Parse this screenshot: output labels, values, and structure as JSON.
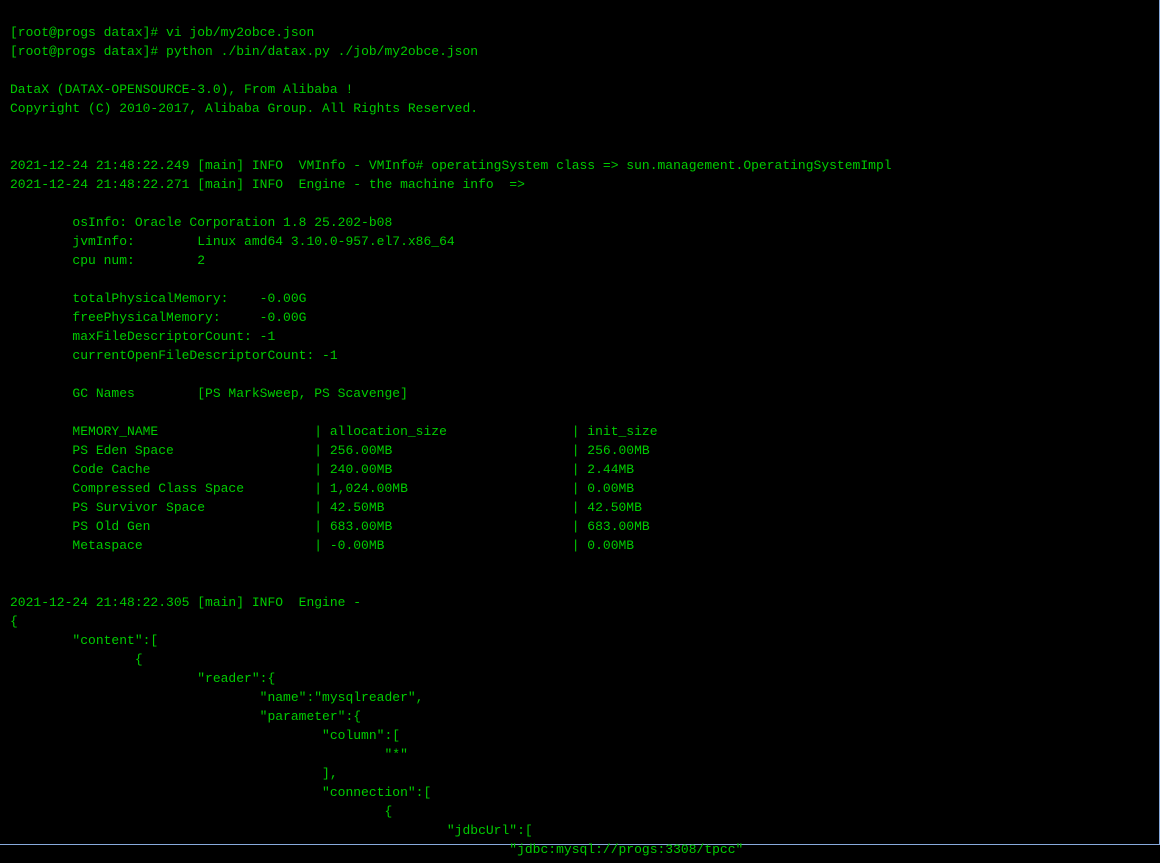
{
  "prompt1": {
    "user_host": "[root@progs datax]# ",
    "command": "vi job/my2obce.json"
  },
  "prompt2": {
    "user_host": "[root@progs datax]# ",
    "command": "python ./bin/datax.py ./job/my2obce.json"
  },
  "banner": {
    "line1": "DataX (DATAX-OPENSOURCE-3.0), From Alibaba !",
    "line2": "Copyright (C) 2010-2017, Alibaba Group. All Rights Reserved."
  },
  "log1": "2021-12-24 21:48:22.249 [main] INFO  VMInfo - VMInfo# operatingSystem class => sun.management.OperatingSystemImpl",
  "log2": "2021-12-24 21:48:22.271 [main] INFO  Engine - the machine info  =>",
  "machine": {
    "osInfo": "        osInfo: Oracle Corporation 1.8 25.202-b08",
    "jvmInfo": "        jvmInfo:        Linux amd64 3.10.0-957.el7.x86_64",
    "cpuNum": "        cpu num:        2",
    "totalMem": "        totalPhysicalMemory:    -0.00G",
    "freeMem": "        freePhysicalMemory:     -0.00G",
    "maxFd": "        maxFileDescriptorCount: -1",
    "curFd": "        currentOpenFileDescriptorCount: -1",
    "gcNames": "        GC Names        [PS MarkSweep, PS Scavenge]"
  },
  "memTable": {
    "header": "        MEMORY_NAME                    | allocation_size                | init_size",
    "row1": "        PS Eden Space                  | 256.00MB                       | 256.00MB",
    "row2": "        Code Cache                     | 240.00MB                       | 2.44MB",
    "row3": "        Compressed Class Space         | 1,024.00MB                     | 0.00MB",
    "row4": "        PS Survivor Space              | 42.50MB                        | 42.50MB",
    "row5": "        PS Old Gen                     | 683.00MB                       | 683.00MB",
    "row6": "        Metaspace                      | -0.00MB                        | 0.00MB"
  },
  "log3": "2021-12-24 21:48:22.305 [main] INFO  Engine - ",
  "json": {
    "l1": "{",
    "l2": "        \"content\":[",
    "l3": "                {",
    "l4": "                        \"reader\":{",
    "l5": "                                \"name\":\"mysqlreader\",",
    "l6": "                                \"parameter\":{",
    "l7": "                                        \"column\":[",
    "l8": "                                                \"*\"",
    "l9": "                                        ],",
    "l10": "                                        \"connection\":[",
    "l11": "                                                {",
    "l12": "                                                        \"jdbcUrl\":[",
    "l13": "                                                                \"jdbc:mysql://progs:3308/tpcc\""
  }
}
